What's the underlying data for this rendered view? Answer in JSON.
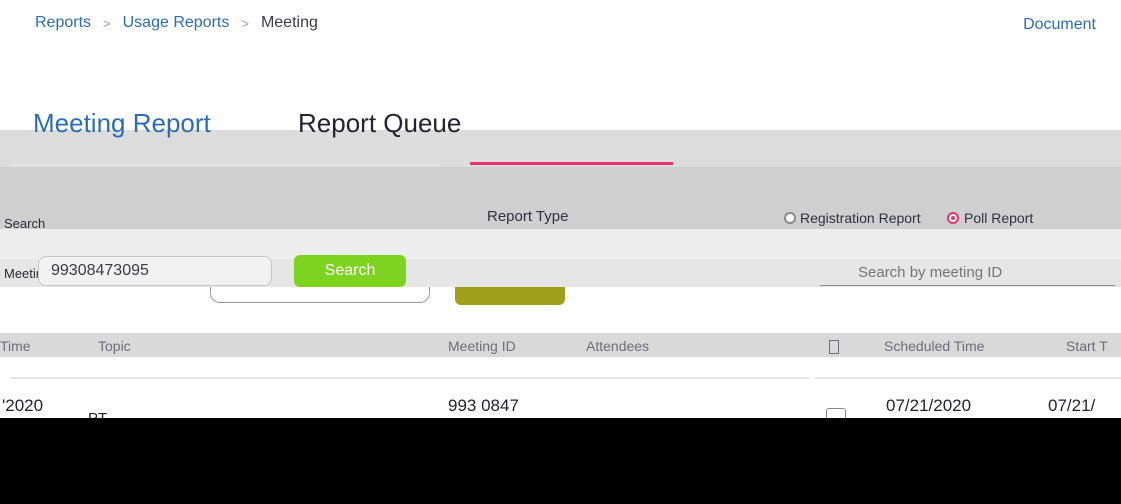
{
  "breadcrumb": {
    "items": [
      "Reports",
      "Usage Reports"
    ],
    "separator": ">",
    "current": "Meeting"
  },
  "document_link": "Document",
  "tabs": [
    {
      "label": "Meeting Report",
      "active": false
    },
    {
      "label": "Report Queue",
      "active": true
    }
  ],
  "filters": {
    "keyword_label": "Search",
    "report_type_label": "Report Type",
    "options": [
      {
        "label": "Registration Report",
        "selected": false
      },
      {
        "label": "Poll Report",
        "selected": true
      }
    ],
    "meeting_label": "Meeting ID",
    "meeting_value": "99308473095",
    "search_button": "Search",
    "search_placeholder": "Search by meeting ID"
  },
  "table": {
    "columns": [
      "Time",
      "Topic",
      "Meeting ID",
      "Attendees",
      "Scheduled Time",
      "Start T"
    ],
    "rows": [
      {
        "time": "'2020",
        "topic": "PT",
        "meeting_id": "993 0847",
        "scheduled": "07/21/2020",
        "start": "07/21/"
      }
    ]
  },
  "colors": {
    "link": "#2d6cb5",
    "accent": "#e8336b",
    "button": "#7ed321"
  }
}
